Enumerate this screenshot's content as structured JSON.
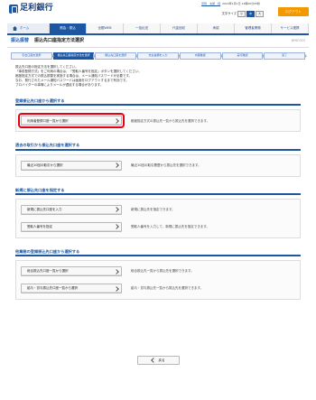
{
  "brand": {
    "name": "足利銀行"
  },
  "user_info": {
    "name": "足利　太郎　様",
    "last_login": "2024年1月1日 12時00分00秒"
  },
  "font_size": {
    "label": "文字サイズ",
    "small": "小",
    "medium": "中",
    "large": "大"
  },
  "header": {
    "logout_label": "ログアウト"
  },
  "nav": {
    "items": [
      {
        "label": "ホーム"
      },
      {
        "label": "照会・振込"
      },
      {
        "label": "全銀WEB"
      },
      {
        "label": "一括伝送"
      },
      {
        "label": "代金回収"
      },
      {
        "label": "承認"
      },
      {
        "label": "管理者業務"
      },
      {
        "label": "サービス連携"
      }
    ]
  },
  "page": {
    "section_name": "振込振替",
    "title": "振込先口座指定方法選択",
    "screen_id": "BFKF003"
  },
  "steps": [
    {
      "label": "引出口座を選択"
    },
    {
      "label": "振込先口座指定方法を選択"
    },
    {
      "label": "振込先口座を選択"
    },
    {
      "label": "支払金額を入力"
    },
    {
      "label": "内容確認"
    },
    {
      "label": "実行確認"
    },
    {
      "label": "完了"
    }
  ],
  "description": {
    "lines": [
      "振込先口座の指定方法を選択してください。",
      "「事前登録方式」をご利用の場合は、「受取人番号を指定」ボタンを選択してください。",
      "都度指定方式での振込振替を実施する場合は、メール通知パスワードが必要です。",
      "なお、発行されたメール通知パスワードは画面をログアウトするまで有効です。",
      "プロバイダーの事情によりメールが遅延する場合があります。"
    ]
  },
  "sections": [
    {
      "title": "登録振込先口座から選択する",
      "actions": [
        {
          "label": "利用者登録口座一覧から選択",
          "note": "都度指定方式の振込先一覧から振込先を選択できます。"
        }
      ]
    },
    {
      "title": "過去の取引から振込先口座を選択する",
      "actions": [
        {
          "label": "最近10回の取引から選択",
          "note": "最近10回の取引履歴から振込先を選択できます。"
        }
      ]
    },
    {
      "title": "新規に振込先口座を指定する",
      "actions": [
        {
          "label": "新規に振込先口座を入力",
          "note": "新規に振込先を指定できます。"
        },
        {
          "label": "受取人番号を指定",
          "note": "受取人番号を入力して、新規に振込先を指定できます。"
        }
      ]
    },
    {
      "title": "他業務の登録振込先口座から選択する",
      "actions": [
        {
          "label": "総合振込先口座一覧から選択",
          "note": "総合振込先一覧から振込先を選択できます。"
        },
        {
          "label": "給与・賞与振込先口座一覧から選択",
          "note": "給与・賞与振込先一覧から振込先を選択できます。"
        }
      ]
    }
  ],
  "back_label": "戻る"
}
